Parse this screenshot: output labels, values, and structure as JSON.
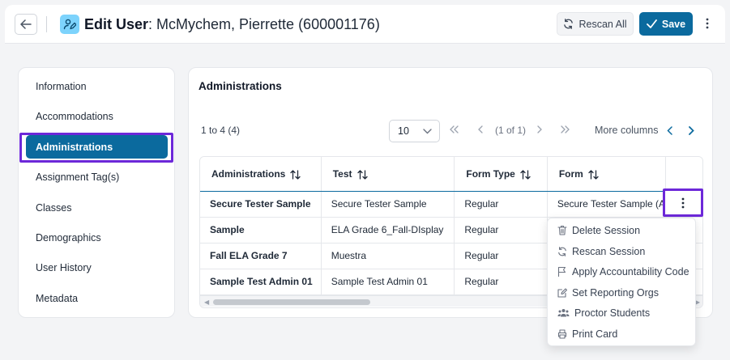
{
  "header": {
    "title_bold": "Edit User",
    "title_rest": ": McMychem, Pierrette (600001176)",
    "rescan_label": "Rescan All",
    "save_label": "Save"
  },
  "sidebar": {
    "items": [
      {
        "label": "Information"
      },
      {
        "label": "Accommodations"
      },
      {
        "label": "Administrations",
        "active": true
      },
      {
        "label": "Assignment Tag(s)"
      },
      {
        "label": "Classes"
      },
      {
        "label": "Demographics"
      },
      {
        "label": "User History"
      },
      {
        "label": "Metadata"
      }
    ]
  },
  "main": {
    "title": "Administrations",
    "range_text": "1 to 4 (4)",
    "page_size": "10",
    "page_info": "(1 of 1)",
    "more_columns_label": "More columns",
    "columns": [
      "Administrations",
      "Test",
      "Form Type",
      "Form"
    ],
    "rows": [
      [
        "Secure Tester Sample",
        "Secure Tester Sample",
        "Regular",
        "Secure Tester Sample (A"
      ],
      [
        "Sample",
        "ELA Grade 6_Fall-DIsplay",
        "Regular",
        ""
      ],
      [
        "Fall ELA Grade 7",
        "Muestra",
        "Regular",
        ""
      ],
      [
        "Sample Test Admin 01",
        "Sample Test Admin 01",
        "Regular",
        ""
      ]
    ]
  },
  "context_menu": {
    "items": [
      {
        "label": "Delete Session",
        "icon": "trash-icon"
      },
      {
        "label": "Rescan Session",
        "icon": "refresh-icon"
      },
      {
        "label": "Apply Accountability Code",
        "icon": "flag-icon"
      },
      {
        "label": "Set Reporting Orgs",
        "icon": "edit-icon"
      },
      {
        "label": "Proctor Students",
        "icon": "users-icon"
      },
      {
        "label": "Print Card",
        "icon": "printer-icon"
      }
    ]
  },
  "colors": {
    "primary": "#0b6a9e",
    "highlight": "#6d28d9",
    "user_icon_bg": "#7dd3fc"
  }
}
